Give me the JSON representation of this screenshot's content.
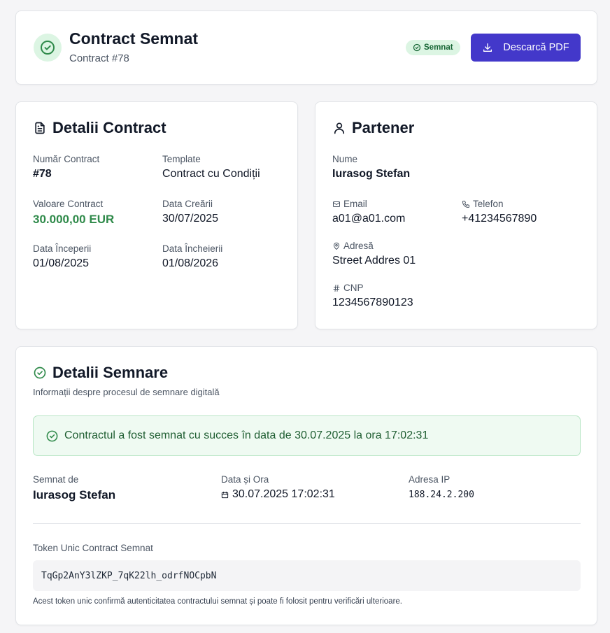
{
  "header": {
    "title": "Contract Semnat",
    "subtitle": "Contract #78",
    "status_badge": "Semnat",
    "download_label": "Descarcă PDF"
  },
  "contract": {
    "title": "Detalii Contract",
    "number_label": "Număr Contract",
    "number_value": "#78",
    "template_label": "Template",
    "template_value": "Contract cu Condiții",
    "value_label": "Valoare Contract",
    "value_value": "30.000,00 EUR",
    "created_label": "Data Creării",
    "created_value": "30/07/2025",
    "start_label": "Data Începerii",
    "start_value": "01/08/2025",
    "end_label": "Data Încheierii",
    "end_value": "01/08/2026"
  },
  "partner": {
    "title": "Partener",
    "name_label": "Nume",
    "name_value": "Iurasog Stefan",
    "email_label": "Email",
    "email_value": "a01@a01.com",
    "phone_label": "Telefon",
    "phone_value": "+41234567890",
    "address_label": "Adresă",
    "address_value": "Street Addres 01",
    "cnp_label": "CNP",
    "cnp_value": "1234567890123"
  },
  "signing": {
    "title": "Detalii Semnare",
    "subtitle": "Informații despre procesul de semnare digitală",
    "success_message": "Contractul a fost semnat cu succes în data de 30.07.2025 la ora 17:02:31",
    "signed_by_label": "Semnat de",
    "signed_by_value": "Iurasog Stefan",
    "datetime_label": "Data și Ora",
    "datetime_value": "30.07.2025 17:02:31",
    "ip_label": "Adresa IP",
    "ip_value": "188.24.2.200",
    "token_label": "Token Unic Contract Semnat",
    "token_value": "TqGp2AnY3lZKP_7qK22lh_odrfNOCpbN",
    "token_note": "Acest token unic confirmă autenticitatea contractului semnat și poate fi folosit pentru verificări ulterioare."
  },
  "colors": {
    "primary": "#4338ca",
    "success": "#2f8a4a",
    "success_bg": "#dcf5e3"
  }
}
